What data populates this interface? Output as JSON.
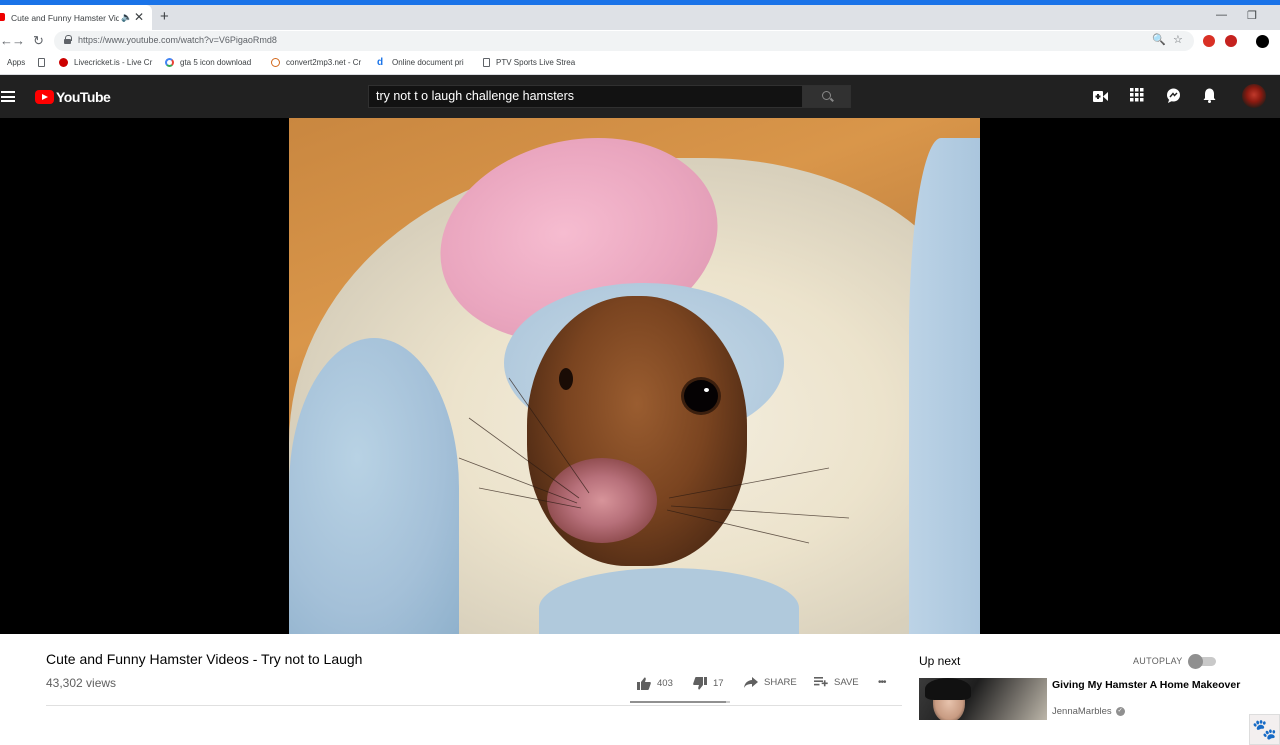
{
  "browser": {
    "tab_title": "Cute and Funny Hamster Vid",
    "url": "https://www.youtube.com/watch?v=V6PigaoRmd8",
    "bookmarks": [
      {
        "label": "Apps"
      },
      {
        "label": ""
      },
      {
        "label": "Livecricket.is - Live Cr"
      },
      {
        "label": "gta 5 icon download"
      },
      {
        "label": "convert2mp3.net - Cr"
      },
      {
        "label": "Online document pri"
      },
      {
        "label": "PTV Sports Live Strea"
      }
    ]
  },
  "youtube": {
    "logo_text": "YouTube",
    "search_query": "try not t o laugh challenge  hamsters"
  },
  "video": {
    "title": "Cute and Funny Hamster Videos - Try not to Laugh",
    "views": "43,302 views",
    "likes": "403",
    "dislikes": "17",
    "like_ratio": 0.96,
    "share_label": "SHARE",
    "save_label": "SAVE",
    "more_label": "•••"
  },
  "sidebar": {
    "up_next": "Up next",
    "autoplay_label": "AUTOPLAY",
    "autoplay_on": false,
    "recommendations": [
      {
        "title": "Giving My Hamster A Home Makeover",
        "channel": "JennaMarbles",
        "verified": true
      }
    ]
  },
  "colors": {
    "browser_accent": "#1a73e8",
    "youtube_header": "#212121",
    "youtube_red": "#ff0000"
  }
}
